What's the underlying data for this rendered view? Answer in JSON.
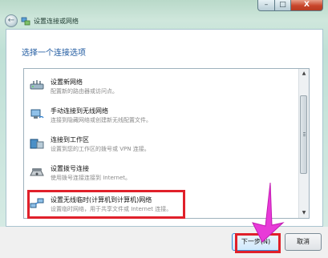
{
  "window": {
    "title": "设置连接或网络",
    "back_glyph": "←",
    "minimize_glyph": "–",
    "maximize_glyph": "□",
    "close_glyph": "X"
  },
  "heading": "选择一个连接选项",
  "options": [
    {
      "icon": "new-network-icon",
      "title": "设置新网络",
      "desc": "配置新的路由器或访问点。"
    },
    {
      "icon": "wireless-connect-icon",
      "title": "手动连接到无线网络",
      "desc": "连接到隐藏网络或创建新无线配置文件。"
    },
    {
      "icon": "workplace-icon",
      "title": "连接到工作区",
      "desc": "设置到您的工作区的拨号或 VPN 连接。"
    },
    {
      "icon": "dialup-icon",
      "title": "设置拨号连接",
      "desc": "使用拨号连接连接到 Internet。"
    },
    {
      "icon": "adhoc-network-icon",
      "title": "设置无线临时(计算机到计算机)网络",
      "desc": "设置临时网络，用于共享文件或 Internet 连接。"
    }
  ],
  "scrollbar": {
    "up_glyph": "▲",
    "down_glyph": "▼"
  },
  "buttons": {
    "next": "下一步(N)",
    "cancel": "取消"
  },
  "colors": {
    "highlight": "#e0202a",
    "pointer": "#e83ad8",
    "heading": "#1f5aa0"
  }
}
